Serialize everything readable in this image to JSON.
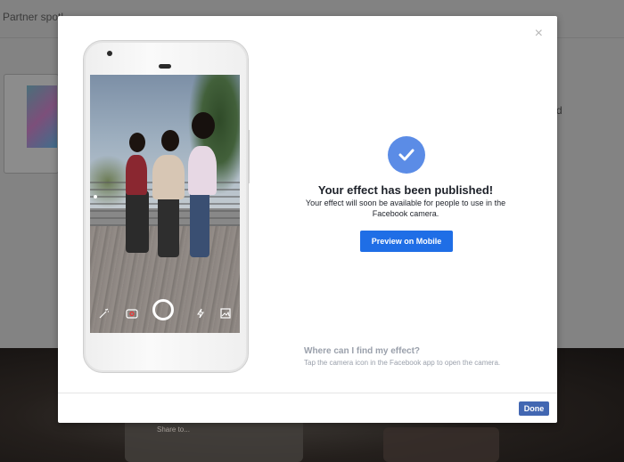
{
  "background": {
    "header_text": "Partner spotl",
    "right_text": "d",
    "video_caption": "Share to..."
  },
  "modal": {
    "close_label": "×",
    "success_title": "Your effect has been published!",
    "success_desc": "Your effect will soon be available for people to use in the Facebook camera.",
    "preview_button": "Preview on Mobile",
    "help_title": "Where can I find my effect?",
    "help_desc": "Tap the camera icon in the Facebook app to open the camera.",
    "done_button": "Done"
  },
  "phone": {
    "toolbar_icons": [
      "effects-wand-icon",
      "camera-flip-icon",
      "shutter-button",
      "flash-icon",
      "gallery-icon"
    ]
  },
  "colors": {
    "accent": "#4267b2",
    "preview_button": "#1f6ee6",
    "check_circle": "#5b8ce6"
  }
}
